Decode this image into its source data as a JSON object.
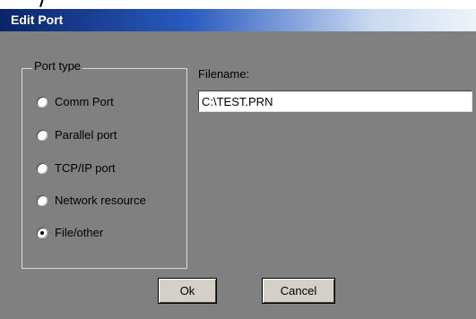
{
  "window": {
    "title": "Edit Port"
  },
  "port_type": {
    "legend": "Port type",
    "options": [
      {
        "label": "Comm Port",
        "checked": false
      },
      {
        "label": "Parallel port",
        "checked": false
      },
      {
        "label": "TCP/IP port",
        "checked": false
      },
      {
        "label": "Network resource",
        "checked": false
      },
      {
        "label": "File/other",
        "checked": true
      }
    ]
  },
  "filename": {
    "label": "Filename:",
    "value": "C:\\TEST.PRN"
  },
  "buttons": {
    "ok": "Ok",
    "cancel": "Cancel"
  }
}
